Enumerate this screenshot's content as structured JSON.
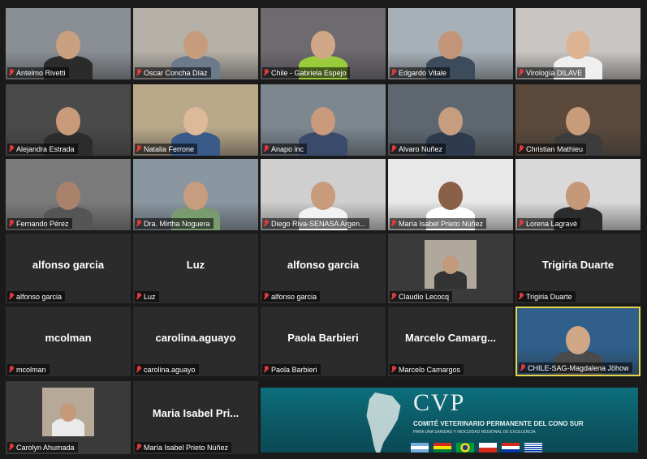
{
  "app": {
    "name": "Zoom gallery view"
  },
  "tiles": [
    {
      "label": "Antelmo Rivetti",
      "type": "video",
      "bg": "#8a8f95",
      "skin": "#c9a080",
      "shirt": "#2b2b2b"
    },
    {
      "label": "Oscar Concha Díaz",
      "type": "video",
      "bg": "#b5b0a8",
      "skin": "#c79c7c",
      "shirt": "#6c7b8c"
    },
    {
      "label": "Chile - Gabriela Espejo",
      "type": "video",
      "bg": "#6d6a70",
      "skin": "#d0a888",
      "shirt": "#9acb3c"
    },
    {
      "label": "Edgardo Vitale",
      "type": "video",
      "bg": "#a7b0b7",
      "skin": "#c29579",
      "shirt": "#3d4c5c"
    },
    {
      "label": "Virología DILAVE",
      "type": "video",
      "bg": "#c8c5c2",
      "skin": "#dcb494",
      "shirt": "#efefef"
    },
    {
      "label": "Alejandra Estrada",
      "type": "video",
      "bg": "#4a4a4a",
      "skin": "#c89a7a",
      "shirt": "#2c2c2c"
    },
    {
      "label": "Natalia Ferrone",
      "type": "video",
      "bg": "#b9a98a",
      "skin": "#dcb999",
      "shirt": "#3a5a8a"
    },
    {
      "label": "Anapo inc",
      "type": "video",
      "bg": "#7c8790",
      "skin": "#c99a7c",
      "shirt": "#3a4a6a"
    },
    {
      "label": "Alvaro Nuñez",
      "type": "video",
      "bg": "#5e6770",
      "skin": "#c79d7f",
      "shirt": "#2e3b4e"
    },
    {
      "label": "Christian Mathieu",
      "type": "video",
      "bg": "#5b4a3c",
      "skin": "#c89b7b",
      "shirt": "#3c3c3c"
    },
    {
      "label": "Fernando Pérez",
      "type": "video",
      "bg": "#7a7a7a",
      "skin": "#a8826a",
      "shirt": "#555"
    },
    {
      "label": "Dra. Mirtha Noguera",
      "type": "video",
      "bg": "#8a96a0",
      "skin": "#c79d7f",
      "shirt": "#7a9a70"
    },
    {
      "label": "Diego Riva-SENASA Argen...",
      "type": "video",
      "bg": "#cfcfcf",
      "skin": "#c89b7d",
      "shirt": "#f2f2f2"
    },
    {
      "label": "María Isabel Prieto Núñez",
      "type": "video",
      "bg": "#e8e8e8",
      "skin": "#8a6048",
      "shirt": "#ffffff"
    },
    {
      "label": "Lorena Lagravé",
      "type": "video",
      "bg": "#d9d9d9",
      "skin": "#c49878",
      "shirt": "#2c2c2c"
    },
    {
      "label": "alfonso garcia",
      "type": "name",
      "name": "alfonso garcia"
    },
    {
      "label": "Luz",
      "type": "name",
      "name": "Luz"
    },
    {
      "label": "alfonso garcia",
      "type": "name",
      "name": "alfonso garcia"
    },
    {
      "label": "Claudio Lecocq",
      "type": "thumb",
      "bg": "#b0a89c",
      "skin": "#c39a7c",
      "shirt": "#333"
    },
    {
      "label": "Trigiria Duarte",
      "type": "name",
      "name": "Trigiria Duarte"
    },
    {
      "label": "mcolman",
      "type": "name",
      "name": "mcolman"
    },
    {
      "label": "carolina.aguayo",
      "type": "name",
      "name": "carolina.aguayo"
    },
    {
      "label": "Paola Barbieri",
      "type": "name",
      "name": "Paola Barbieri"
    },
    {
      "label": "Marcelo Camargos",
      "type": "name",
      "name": "Marcelo  Camarg..."
    },
    {
      "label": "CHILE-SAG-Magdalena Jöhow",
      "type": "video",
      "bg": "#2f5f8a",
      "skin": "#d0a888",
      "shirt": "#4a4a4a",
      "active": true
    },
    {
      "label": "Carolyn Ahumada",
      "type": "thumb",
      "bg": "#b7a998",
      "skin": "#c49a7a",
      "shirt": "#eaeaea"
    },
    {
      "label": "María Isabel Prieto Núñez",
      "type": "name",
      "name": "Maria  Isabel  Pri..."
    }
  ],
  "banner": {
    "logo": "CVP",
    "line1": "COMITÉ VETERINARIO PERMANENTE DEL CONO SUR",
    "line2": "PARA UNA SANIDAD Y INOCUIDAD REGIONAL DE EXCELENCIA",
    "flags": [
      "argentina",
      "bolivia",
      "brasil",
      "chile",
      "paraguay",
      "uruguay"
    ]
  }
}
